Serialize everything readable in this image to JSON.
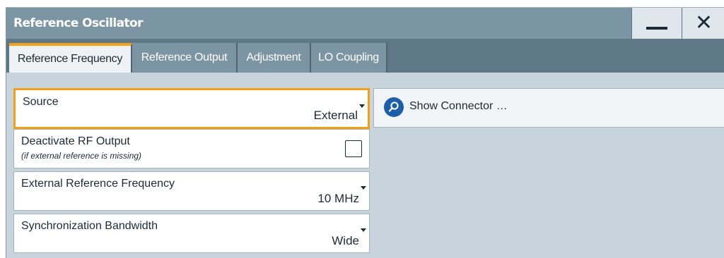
{
  "window": {
    "title": "Reference Oscillator",
    "minimize_icon": "minimize-icon",
    "close_icon": "close-icon"
  },
  "tabs": [
    {
      "label": "Reference Frequency",
      "active": true
    },
    {
      "label": "Reference Output",
      "active": false
    },
    {
      "label": "Adjustment",
      "active": false
    },
    {
      "label": "LO Coupling",
      "active": false
    }
  ],
  "fields": {
    "source": {
      "label": "Source",
      "value": "External"
    },
    "deactivate": {
      "label": "Deactivate RF Output",
      "sub": "(if external reference is missing)",
      "checked": false
    },
    "ext_ref_freq": {
      "label": "External Reference Frequency",
      "value": "10 MHz"
    },
    "sync_bw": {
      "label": "Synchronization Bandwidth",
      "value": "Wide"
    }
  },
  "show_connector": {
    "label": "Show Connector …",
    "icon": "search-icon"
  },
  "colors": {
    "accent": "#f3a014",
    "titlebar": "#7b95a4",
    "tabbar": "#5f7887",
    "panel": "#c8d4db",
    "icon_blue": "#1a5fa8"
  }
}
